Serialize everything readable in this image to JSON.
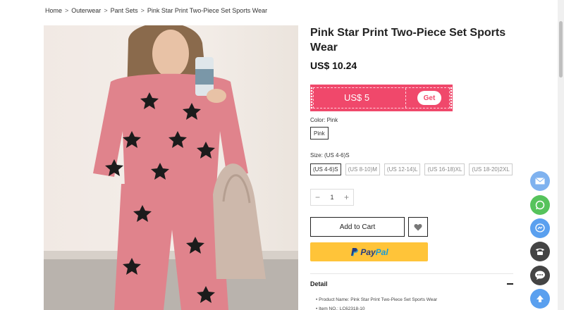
{
  "breadcrumb": [
    {
      "label": "Home"
    },
    {
      "label": "Outerwear"
    },
    {
      "label": "Pant Sets"
    },
    {
      "label": "Pink Star Print Two-Piece Set Sports Wear"
    }
  ],
  "breadcrumb_separator": ">",
  "product": {
    "title": "Pink Star Print Two-Piece Set Sports Wear",
    "price": "US$ 10.24",
    "photo_colors": {
      "outfit": "#e0838c",
      "stars": "#1b1b1b",
      "background": "#f1ebe6"
    }
  },
  "coupon": {
    "amount": "US$ 5",
    "get_label": "Get",
    "color": "#f0486b"
  },
  "color": {
    "label": "Color: Pink",
    "options": [
      "Pink"
    ]
  },
  "size": {
    "label": "Size: (US 4-6)S",
    "options": [
      "(US 4-6)S",
      "(US 8-10)M",
      "(US 12-14)L",
      "(US 16-18)XL",
      "(US 18-20)2XL"
    ],
    "selected": "(US 4-6)S"
  },
  "quantity": {
    "value": "1",
    "minus": "−",
    "plus": "+"
  },
  "actions": {
    "add_to_cart": "Add to Cart",
    "wishlist_icon": "heart-icon"
  },
  "paypal": {
    "pay": "Pay",
    "pal": "Pal",
    "color": "#ffc439"
  },
  "detail": {
    "heading": "Detail",
    "items": [
      "Product Name: Pink Star Print Two-Piece Set Sports Wear",
      "Item NO.: LC62318-10"
    ]
  },
  "floating_buttons": [
    {
      "icon": "mail-icon",
      "color": "#7fb2ef"
    },
    {
      "icon": "whatsapp-icon",
      "color": "#56c35c"
    },
    {
      "icon": "messenger-icon",
      "color": "#5aa0ef"
    },
    {
      "icon": "phone-icon",
      "color": "#444444"
    },
    {
      "icon": "chat-icon",
      "color": "#444444"
    },
    {
      "icon": "arrow-up-icon",
      "color": "#5aa0ef"
    }
  ]
}
